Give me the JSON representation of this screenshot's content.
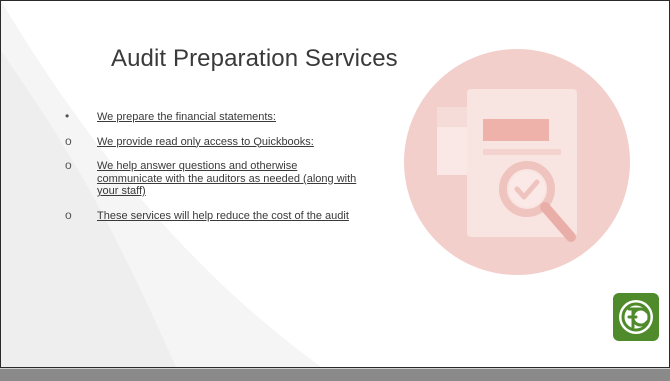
{
  "slide": {
    "title": "Audit Preparation Services",
    "bullets": [
      {
        "marker": "•",
        "text": "We prepare the financial statements:"
      },
      {
        "marker": "o",
        "text": "We provide read only access to Quickbooks:"
      },
      {
        "marker": "o",
        "text": "We help answer questions and otherwise communicate with the auditors as needed (along with your staff)"
      },
      {
        "marker": "o",
        "text": "These services will help reduce the cost of the audit"
      }
    ]
  },
  "illustration": {
    "icon": "document-magnifier-icon",
    "circle_color": "#f3c9c4"
  },
  "logo": {
    "icon": "fc-logo",
    "color": "#4f8a2b"
  },
  "colors": {
    "accent": "#e89a92",
    "footer": "#8a8a8a",
    "text": "#3a3a3a"
  }
}
